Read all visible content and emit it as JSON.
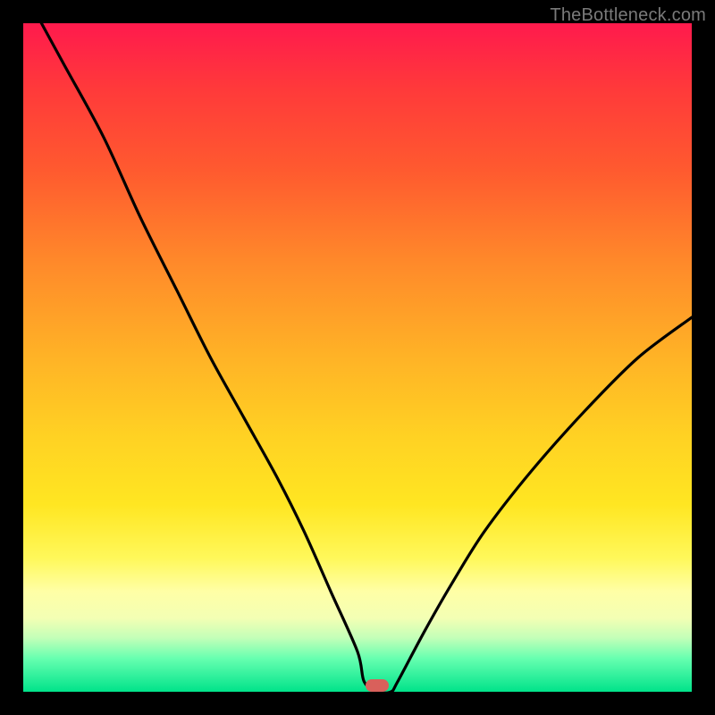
{
  "watermark": {
    "text": "TheBottleneck.com"
  },
  "marker": {
    "color": "#d9605b",
    "x_ratio": 0.53,
    "y_ratio": 0.991
  },
  "chart_data": {
    "type": "line",
    "title": "",
    "xlabel": "",
    "ylabel": "",
    "xlim": [
      0,
      1
    ],
    "ylim": [
      0,
      100
    ],
    "grid": false,
    "legend": false,
    "series": [
      {
        "name": "bottleneck-curve",
        "x": [
          0.0,
          0.06,
          0.12,
          0.175,
          0.23,
          0.28,
          0.33,
          0.38,
          0.42,
          0.46,
          0.5,
          0.51,
          0.53,
          0.55,
          0.56,
          0.6,
          0.64,
          0.69,
          0.76,
          0.84,
          0.92,
          1.0
        ],
        "values": [
          105.0,
          94.0,
          83.0,
          71.0,
          60.0,
          50.0,
          41.0,
          32.0,
          24.0,
          15.0,
          6.0,
          1.5,
          0.0,
          0.0,
          1.5,
          9.0,
          16.0,
          24.0,
          33.0,
          42.0,
          50.0,
          56.0
        ]
      }
    ],
    "annotations": [
      {
        "type": "marker",
        "x": 0.53,
        "y": 0,
        "label": "optimal-point"
      }
    ]
  }
}
